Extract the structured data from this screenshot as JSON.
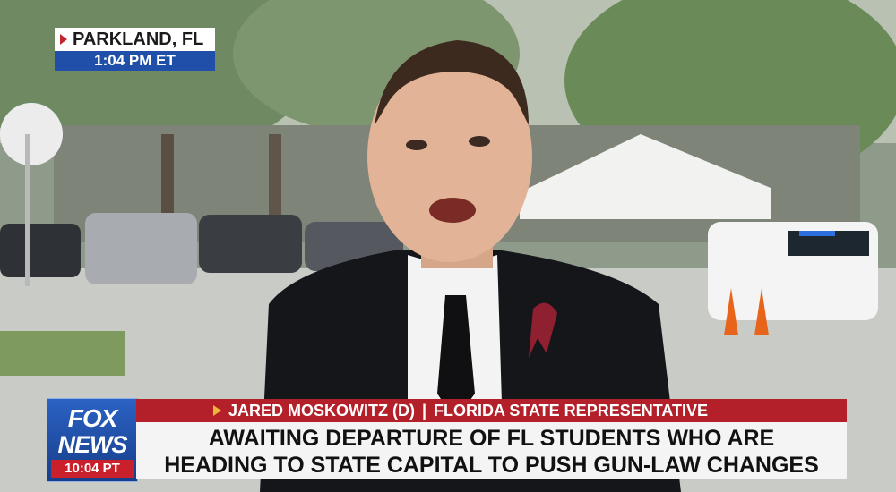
{
  "location_bug": {
    "place": "PARKLAND, FL",
    "time": "1:04 PM ET"
  },
  "network_logo": {
    "line1": "FOX",
    "line2": "NEWS",
    "time": "10:04 PT"
  },
  "lower_third": {
    "name": "JARED MOSKOWITZ (D)",
    "separator": "|",
    "title": "FLORIDA STATE REPRESENTATIVE",
    "headline_line1": "AWAITING DEPARTURE OF FL STUDENTS WHO ARE",
    "headline_line2": "HEADING TO STATE CAPITAL TO PUSH GUN-LAW CHANGES"
  },
  "colors": {
    "fox_blue": "#1f4fa8",
    "alert_red": "#b3202a",
    "accent_gold": "#f0b63a"
  }
}
